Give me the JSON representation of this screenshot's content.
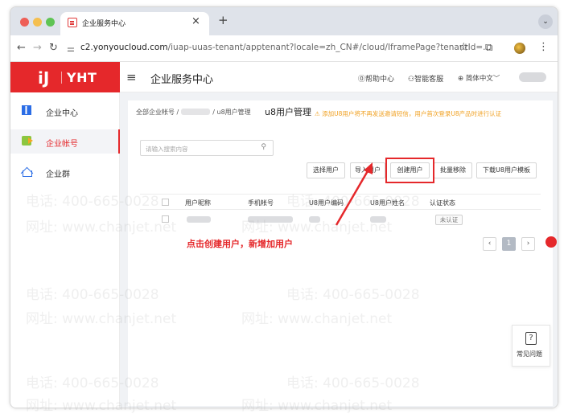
{
  "browser": {
    "tab_title": "企业服务中心",
    "tab_close": "×",
    "new_tab": "+",
    "tab_menu": "⌄",
    "url_host": "c2.yonyoucloud.com",
    "url_path": "/iuap-uuas-tenant/apptenant?locale=zh_CN#/cloud/IframePage?tenantId=..."
  },
  "header": {
    "logo_mark": "iJ",
    "logo_text": "YHT",
    "app_title": "企业服务中心",
    "help": "⓪帮助中心",
    "smart_service": "⚇智能客服",
    "language": "简体中文﹀"
  },
  "sidebar": {
    "items": [
      {
        "label": "企业中心",
        "icon": "org-icon"
      },
      {
        "label": "企业帐号",
        "icon": "account-icon"
      },
      {
        "label": "企业群",
        "icon": "home-icon"
      }
    ]
  },
  "breadcrumb": {
    "root": "全部企业帐号 /",
    "sep": "/",
    "mid": "u8用户管理",
    "current": "u8用户管理"
  },
  "notice": "⚠ 添加U8用户将不再发送邀请短信，用户首次登录U8产品时进行认证",
  "search": {
    "placeholder": "请输入搜索内容",
    "icon": "⚲"
  },
  "toolbar": {
    "select_user": "选择用户",
    "import_user": "导入用户",
    "create_user": "创建用户",
    "batch_remove": "批量移除",
    "download_template": "下载U8用户模板"
  },
  "table": {
    "columns": [
      "用户昵称",
      "手机帐号",
      "U8用户编码",
      "U8用户姓名",
      "认证状态"
    ],
    "rows": [
      {
        "status": "未认证"
      }
    ]
  },
  "pagination": {
    "prev": "‹",
    "current": "1",
    "next": "›"
  },
  "annotation": "点击创建用户，新增加用户",
  "faq": {
    "icon": "?",
    "label": "常见问题"
  },
  "watermark": {
    "phone": "电话: 400-665-0028",
    "site": "网址: www.chanjet.net"
  },
  "colors": {
    "brand_red": "#e5282b",
    "notice_orange": "#f0a020"
  }
}
